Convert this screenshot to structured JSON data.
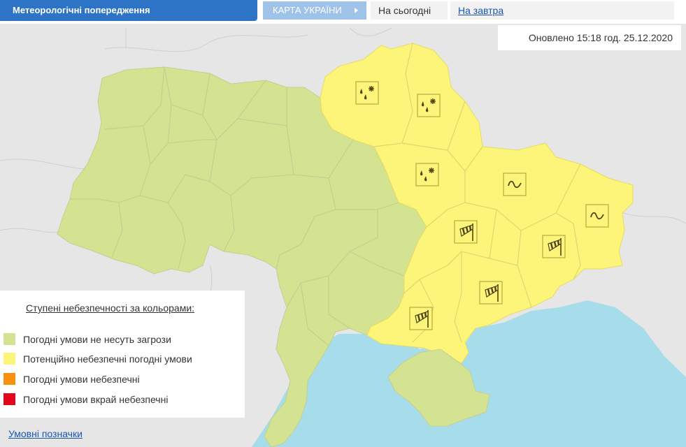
{
  "header": {
    "title": "Метеорологічні попередження",
    "map_tab": "КАРТА УКРАЇНИ",
    "today_tab": "На сьогодні",
    "tomorrow_tab": "На завтра"
  },
  "updated_text": "Оновлено 15:18 год. 25.12.2020",
  "legend": {
    "title": "Ступені небезпечності за кольорами:",
    "items": [
      {
        "label": "Погодні умови не несуть загрози",
        "color": "#d3e392"
      },
      {
        "label": "Потенційно небезпечні погодні умови",
        "color": "#fdf579"
      },
      {
        "label": "Погодні умови небезпечні",
        "color": "#f8910f"
      },
      {
        "label": "Погодні умови вкрай небезпечні",
        "color": "#e3071d"
      }
    ]
  },
  "footer_link": "Умовні позначки",
  "map": {
    "colors": {
      "safe": "#d3e392",
      "caution": "#fdf579",
      "sea": "#a7dcea",
      "neighbor": "#e6e6e6",
      "border": "#c4cf90",
      "icon": "#4d4313"
    },
    "warning_icons": [
      {
        "region": "chernihiv",
        "type": "rain-snow-icon"
      },
      {
        "region": "sumy",
        "type": "rain-snow-icon"
      },
      {
        "region": "poltava",
        "type": "rain-snow-icon"
      },
      {
        "region": "kharkiv",
        "type": "fog-icon"
      },
      {
        "region": "luhansk",
        "type": "fog-icon"
      },
      {
        "region": "dnipro",
        "type": "wind-icon"
      },
      {
        "region": "donetsk",
        "type": "wind-icon"
      },
      {
        "region": "zaporizhzhia",
        "type": "wind-icon"
      },
      {
        "region": "kherson",
        "type": "wind-icon"
      }
    ]
  }
}
